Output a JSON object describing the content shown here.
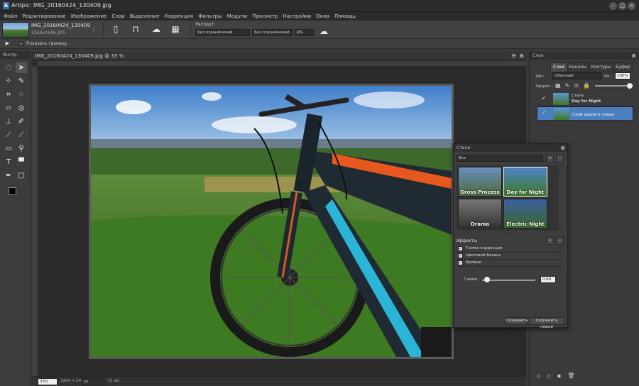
{
  "window": {
    "title": "Artipic: IMG_20160424_130409.jpg"
  },
  "menu": [
    "Файл",
    "Редактирование",
    "Изображение",
    "Слои",
    "Выделение",
    "Коррекция",
    "Фильтры",
    "Модули",
    "Просмотр",
    "Настройки",
    "Окна",
    "Помощь"
  ],
  "file": {
    "name": "IMG_20160424_130409",
    "info": "3264x2448, JPG"
  },
  "export": {
    "label": "Экспорт:",
    "size1": "Без ограничений",
    "size2": "Без ограничений",
    "format": "JPG"
  },
  "options": {
    "show_border": "Показать границу"
  },
  "tools_panel": {
    "title": "Инстр."
  },
  "document": {
    "tab_title": "IMG_20160424_130409.jpg @ 33 %",
    "zoom": "33%",
    "size": "3264 × 2448",
    "unit": "px",
    "dpi": "72 dpi"
  },
  "layers_panel": {
    "title": "Слои",
    "tabs": [
      "Слои",
      "Каналы",
      "Контуры",
      "Буфер"
    ],
    "mode_label": "Тип:",
    "mode": "Обычный",
    "opacity_label": "Не...",
    "opacity": "100%",
    "lock_label": "Закреп.:",
    "layers": [
      {
        "name": "Стиль",
        "sub": "Day for Night",
        "selected": false
      },
      {
        "name": "Слой заднего плана",
        "selected": true
      }
    ]
  },
  "styles_panel": {
    "title": "Стили",
    "filter": "Все",
    "items": [
      "Gross Process",
      "Day for Night",
      "Drama",
      "Electric Night"
    ],
    "effects_title": "Эффекты",
    "effects": [
      "Гамма-коррекция",
      "Цветовой баланс",
      "Кривые"
    ],
    "gamma_label": "Гамма:",
    "gamma_value": "0,69",
    "save_btn": "Сохранить",
    "save_new_btn": "Сохранить новый"
  },
  "colors": {
    "accent": "#4a7fc0",
    "sky": "#5b95d6",
    "grass": "#3f7a24",
    "bike_frame": "#1f2a33",
    "bike_cyan": "#2ab5d6",
    "bike_orange": "#e8581e"
  }
}
